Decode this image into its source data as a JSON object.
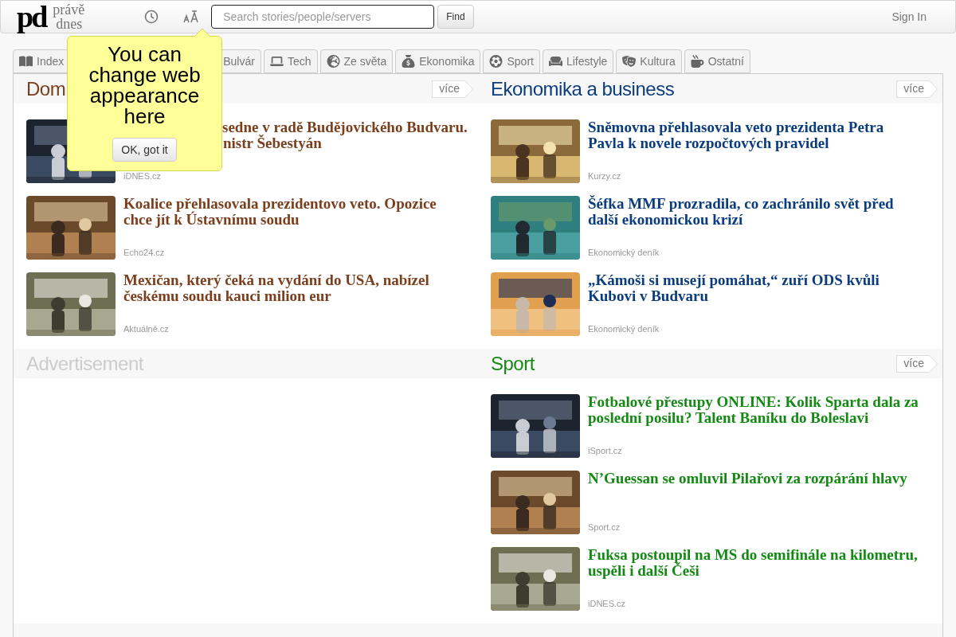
{
  "header": {
    "logo_mark": "pd",
    "logo_words": [
      "právě",
      "dnes"
    ],
    "search": {
      "placeholder": "Search stories/people/servers"
    },
    "find_button": "Find",
    "sign_in": "Sign In"
  },
  "tooltip": {
    "text": "You can change web appearance here",
    "button": "OK, got it"
  },
  "tabs": [
    {
      "label": "Index",
      "selected": false
    },
    {
      "label": "Bulvár",
      "selected": false
    },
    {
      "label": "Tech",
      "selected": false
    },
    {
      "label": "Ze světa",
      "selected": false
    },
    {
      "label": "Ekonomika",
      "selected": false
    },
    {
      "label": "Sport",
      "selected": false
    },
    {
      "label": "Lifestyle",
      "selected": false
    },
    {
      "label": "Kultura",
      "selected": false
    },
    {
      "label": "Ostatní",
      "selected": false
    }
  ],
  "sections": [
    {
      "kind": "news",
      "title": "Dom",
      "color": "#7b3f1d",
      "more": "více",
      "articles": [
        {
          "title_fragments": [
            "sedne v radě Budějovického Budvaru.",
            "nistr Šebestyán"
          ],
          "source": "iDNES.cz"
        },
        {
          "title": "Koalice přehlasovala prezidentovo veto. Opozice chce jít k Ústavnímu soudu",
          "source": "Echo24.cz"
        },
        {
          "title": "Mexičan, který čeká na vydání do USA, nabízel českému soudu kauci milion eur",
          "source": "Aktuálně.cz"
        }
      ]
    },
    {
      "kind": "news",
      "title": "Ekonomika a business",
      "color": "#0b3d7e",
      "more": "více",
      "articles": [
        {
          "title": "Sněmovna přehlasovala veto prezidenta Petra Pavla k novele rozpočtových pravidel",
          "source": "Kurzy.cz"
        },
        {
          "title": "Šéfka MMF prozradila, co zachránilo svět před další ekonomickou krizí",
          "source": "Ekonomický deník"
        },
        {
          "title": "„Kámoši si musejí pomáhat,“ zuří ODS kvůli Kubovi v Budvaru",
          "source": "Ekonomický deník"
        }
      ]
    },
    {
      "kind": "ad",
      "title": "Advertisement",
      "color": "#cccccc"
    },
    {
      "kind": "news",
      "title": "Sport",
      "color": "#148a14",
      "more": "více",
      "articles": [
        {
          "title": "Fotbalové přestupy ONLINE: Kolik Sparta dala za poslední posilu? Talent Baníku do Boleslavi",
          "source": "iSport.cz"
        },
        {
          "title": "N’Guessan se omluvil Pilařovi za rozpárání hlavy",
          "source": "Sport.cz"
        },
        {
          "title": "Fuksa postoupil na MS do semifinále na kilometru, uspěli i další Češi",
          "source": "iDNES.cz"
        }
      ]
    }
  ]
}
